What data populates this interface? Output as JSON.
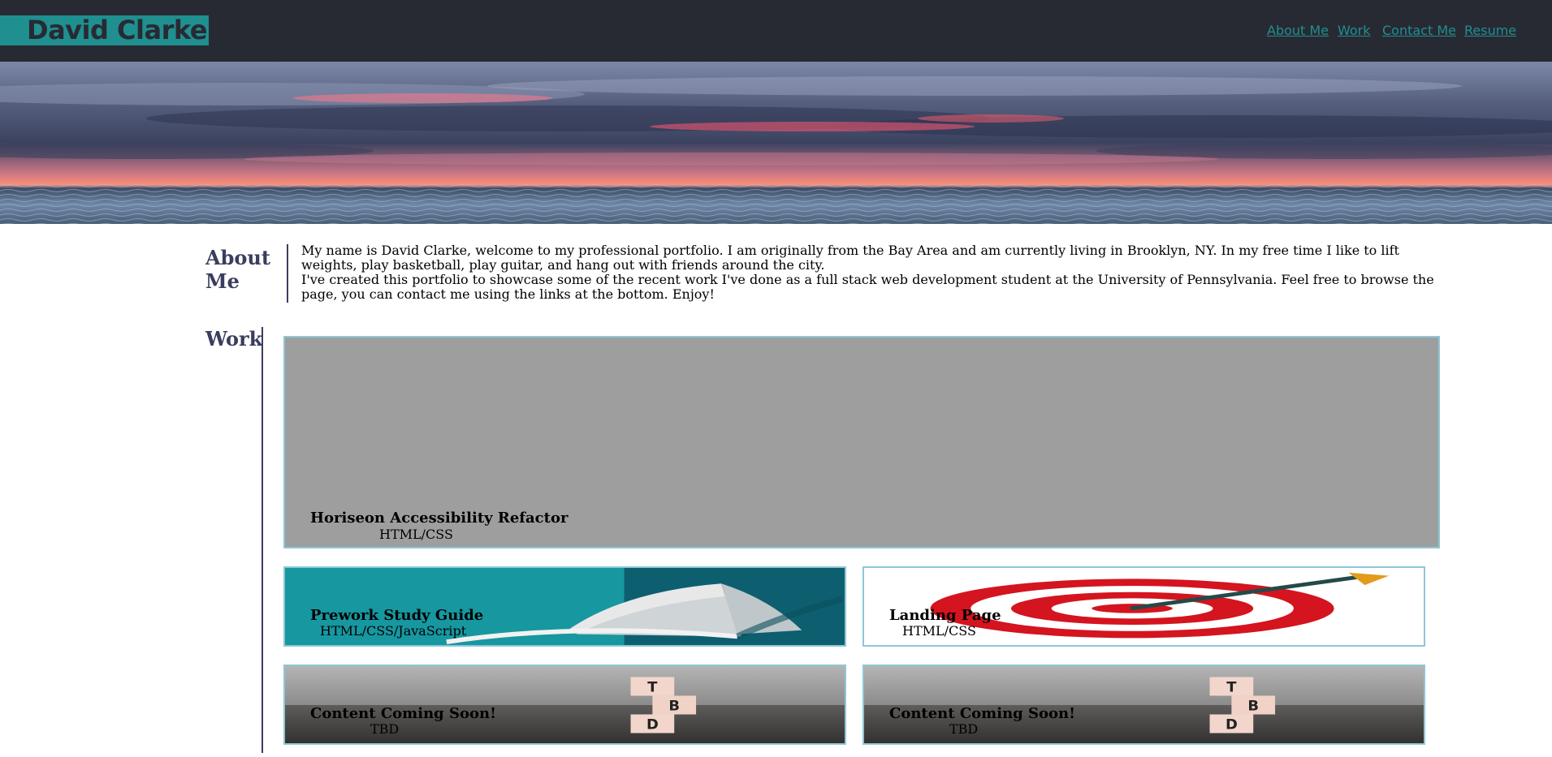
{
  "header": {
    "brand": "David Clarke",
    "nav": [
      "About Me",
      "Work",
      "Contact Me",
      "Resume"
    ]
  },
  "about": {
    "title": "About Me",
    "paragraphs": [
      "My name is David Clarke, welcome to my professional portfolio. I am originally from the Bay Area and am currently living in Brooklyn, NY. In my free time I like to lift weights, play basketball, play guitar, and hang out with friends around the city.",
      "I've created this portfolio to showcase some of the recent work I've done as a full stack web development student at the University of Pennsylvania. Feel free to browse the page, you can contact me using the links at the bottom. Enjoy!"
    ]
  },
  "work": {
    "title": "Work",
    "projects": [
      {
        "title": "Horiseon Accessibility Refactor",
        "tech": "HTML/CSS"
      },
      {
        "title": "Prework Study Guide",
        "tech": "HTML/CSS/JavaScript"
      },
      {
        "title": "Landing Page",
        "tech": "HTML/CSS"
      },
      {
        "title": "Content Coming Soon!",
        "tech": "TBD"
      },
      {
        "title": "Content Coming Soon!",
        "tech": "TBD"
      }
    ]
  },
  "colors": {
    "header_bg": "#282a33",
    "accent": "#1f8f90",
    "heading": "#393e5e",
    "card_border": "#8fc7d5"
  }
}
